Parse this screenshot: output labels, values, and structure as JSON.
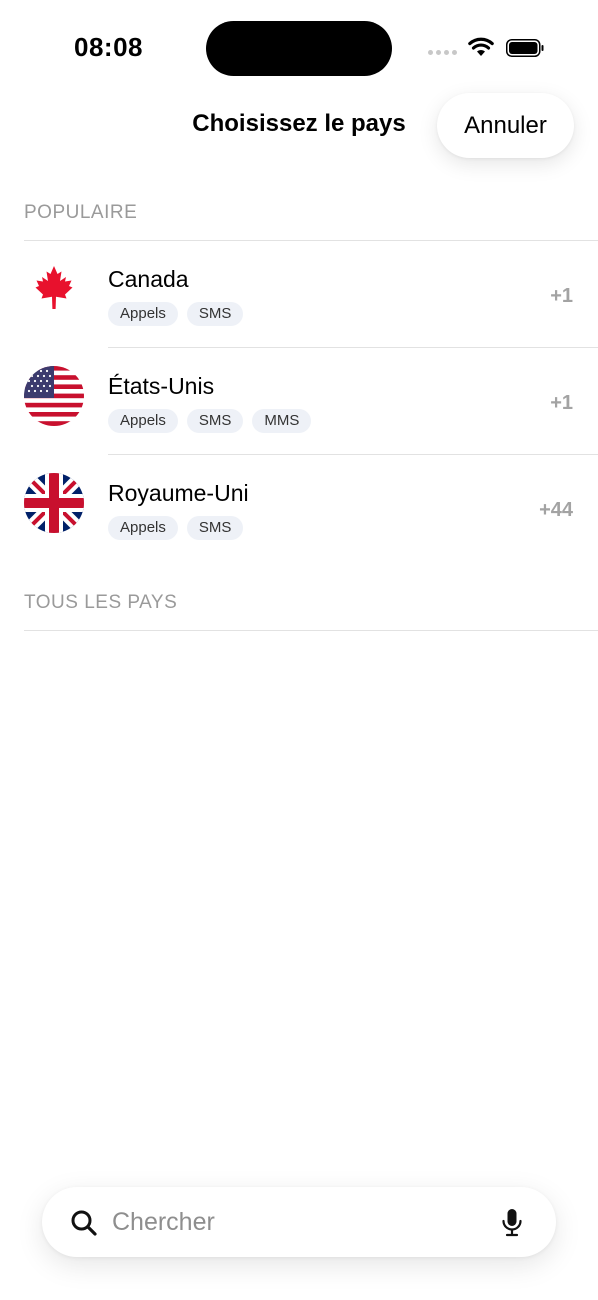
{
  "status_bar": {
    "time": "08:08"
  },
  "header": {
    "title": "Choisissez le pays",
    "cancel_label": "Annuler"
  },
  "sections": {
    "popular": {
      "title": "POPULAIRE",
      "countries": [
        {
          "name": "Canada",
          "code": "+1",
          "services": [
            "Appels",
            "SMS"
          ],
          "flag_icon": "canada-flag-icon"
        },
        {
          "name": "États-Unis",
          "code": "+1",
          "services": [
            "Appels",
            "SMS",
            "MMS"
          ],
          "flag_icon": "usa-flag-icon"
        },
        {
          "name": "Royaume-Uni",
          "code": "+44",
          "services": [
            "Appels",
            "SMS"
          ],
          "flag_icon": "uk-flag-icon"
        }
      ]
    },
    "all": {
      "title": "TOUS LES PAYS"
    }
  },
  "search": {
    "placeholder": "Chercher",
    "value": ""
  },
  "colors": {
    "tag_bg": "#eef1f7",
    "section_header": "#9a9a9a",
    "dial_code": "#a3a3a3"
  }
}
